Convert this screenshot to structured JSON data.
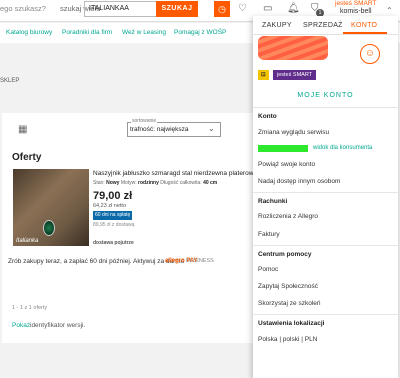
{
  "header": {
    "search_text": "ego szukasz?",
    "search_scope": "szukaj wielu",
    "scope_value": "ITALIANKAA",
    "search_button": "SZUKAJ",
    "bag_count": "1",
    "smart_brand": "jesteś SMART",
    "user_name": "komis-bell"
  },
  "nav": {
    "links": [
      "Katalog biurowy",
      "Poradniki dla firm",
      "Weź w Leasing",
      "Pomagaj z WOŚP"
    ]
  },
  "breadcrumb": "SKLEP",
  "results": {
    "sort_label": "sortowanie",
    "sort_value": "trafność: największa",
    "offers_title": "Oferty",
    "product": {
      "watermark": "Italianka",
      "title": "Naszyjnik jabłuszko szmaragd stal nierdzewna platerowan",
      "meta_state_label": "Stan:",
      "meta_state": "Nowy",
      "meta_pattern_label": "Motyw:",
      "meta_pattern": "rodzinny",
      "meta_length_label": "Długość całkowita:",
      "meta_length": "40 cm",
      "price": "79,00 zł",
      "netto": "64,23 zł netto",
      "installment_badge": "60 dni na spłatę",
      "delivery_price": "89,95 zł z dostawą",
      "delivery_label": "dostawa pojutrze"
    },
    "pay_later_text": "Zrób zakupy teraz, a zapłać 60 dni później. Aktywuj za darmo",
    "pay_brand": "allegro PAY",
    "pay_business": "BUSINESS",
    "pagination": "1 - 1 z 1 oferty",
    "identifier_link": "Pokaż",
    "identifier_rest": "identyfikator wersji."
  },
  "menu": {
    "tabs": [
      "ZAKUPY",
      "SPRZEDAŻ",
      "KONTO"
    ],
    "smart_tag": "⊡",
    "smart_badge": "jesteś SMART",
    "my_account": "MOJE KONTO",
    "consumer_view": "widok dla konsumenta",
    "sections": [
      {
        "title": "Konto",
        "items": [
          "Zmiana wyglądu serwisu",
          "Powiąż swoje konto",
          "Nadaj dostęp innym osobom"
        ]
      },
      {
        "title": "Rachunki",
        "items": [
          "Rozliczenia z Allegro",
          "Faktury"
        ]
      },
      {
        "title": "Centrum pomocy",
        "items": [
          "Pomoc",
          "Zapytaj Społeczność",
          "Skorzystaj ze szkoleń"
        ]
      },
      {
        "title": "Ustawienia lokalizacji",
        "items": [
          "Polska | polski | PLN"
        ]
      }
    ]
  },
  "colors": {
    "accent": "#ff5a00",
    "link": "#00a790",
    "installment": "#0b6aa8"
  }
}
